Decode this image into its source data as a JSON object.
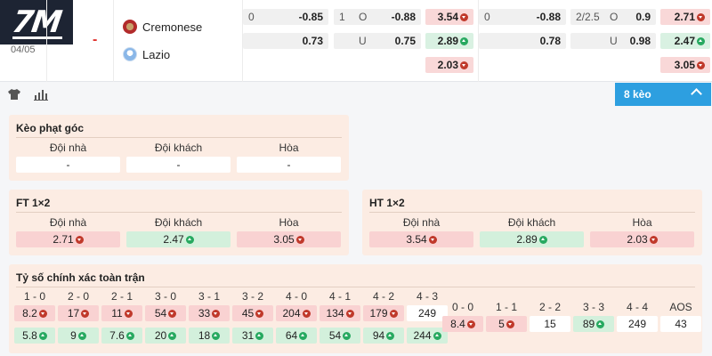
{
  "match": {
    "date": "04/05",
    "status": "-",
    "home_team": "Cremonese",
    "away_team": "Lazio",
    "row1": {
      "hdp_line": "0",
      "hdp_home": "-0.85",
      "ou_line": "1",
      "ou_o_label": "O",
      "ou_o": "-0.88",
      "x12_home": "3.54",
      "h1_hdp_line": "0",
      "h1_hdp_home": "-0.88",
      "h1_ou_line": "2/2.5",
      "h1_ou_o_label": "O",
      "h1_ou_o": "0.9",
      "h1_x12_home": "2.71"
    },
    "row2": {
      "hdp_away": "0.73",
      "ou_u_label": "U",
      "ou_u": "0.75",
      "x12_away": "2.89",
      "h1_hdp_away": "0.78",
      "h1_ou_u_label": "U",
      "h1_ou_u": "0.98",
      "h1_x12_away": "2.47"
    },
    "row3": {
      "x12_draw": "2.03",
      "h1_x12_draw": "3.05"
    }
  },
  "toolbar": {
    "keo_label": "8 kèo"
  },
  "corner": {
    "title": "Kèo phạt góc",
    "headers": [
      "Đội nhà",
      "Đội khách",
      "Hòa"
    ],
    "values": [
      "-",
      "-",
      "-"
    ]
  },
  "ft": {
    "title": "FT 1×2",
    "headers": [
      "Đội nhà",
      "Đội khách",
      "Hòa"
    ],
    "values": [
      "2.71",
      "2.47",
      "3.05"
    ],
    "trends": [
      "down",
      "up",
      "down"
    ]
  },
  "ht": {
    "title": "HT 1×2",
    "headers": [
      "Đội nhà",
      "Đội khách",
      "Hòa"
    ],
    "values": [
      "3.54",
      "2.89",
      "2.03"
    ],
    "trends": [
      "down",
      "up",
      "down"
    ]
  },
  "exact": {
    "title": "Tỷ số chính xác toàn trận",
    "home_labels": [
      "1 - 0",
      "2 - 0",
      "2 - 1",
      "3 - 0",
      "3 - 1",
      "3 - 2",
      "4 - 0",
      "4 - 1",
      "4 - 2",
      "4 - 3"
    ],
    "home_row1": [
      "8.2",
      "17",
      "11",
      "54",
      "33",
      "45",
      "204",
      "134",
      "179",
      "249"
    ],
    "home_row1_trend": [
      "down",
      "down",
      "down",
      "down",
      "down",
      "down",
      "down",
      "down",
      "down",
      "none"
    ],
    "home_row2": [
      "5.8",
      "9",
      "7.6",
      "20",
      "18",
      "31",
      "64",
      "54",
      "94",
      "244"
    ],
    "home_row2_trend": [
      "up",
      "up",
      "up",
      "up",
      "up",
      "up",
      "up",
      "up",
      "up",
      "up"
    ],
    "draw_labels": [
      "0 - 0",
      "1 - 1",
      "2 - 2",
      "3 - 3",
      "4 - 4",
      "AOS"
    ],
    "draw_values": [
      "8.4",
      "5",
      "15",
      "89",
      "249",
      "43"
    ],
    "draw_trend": [
      "down",
      "down",
      "none",
      "up",
      "none",
      "none"
    ]
  }
}
